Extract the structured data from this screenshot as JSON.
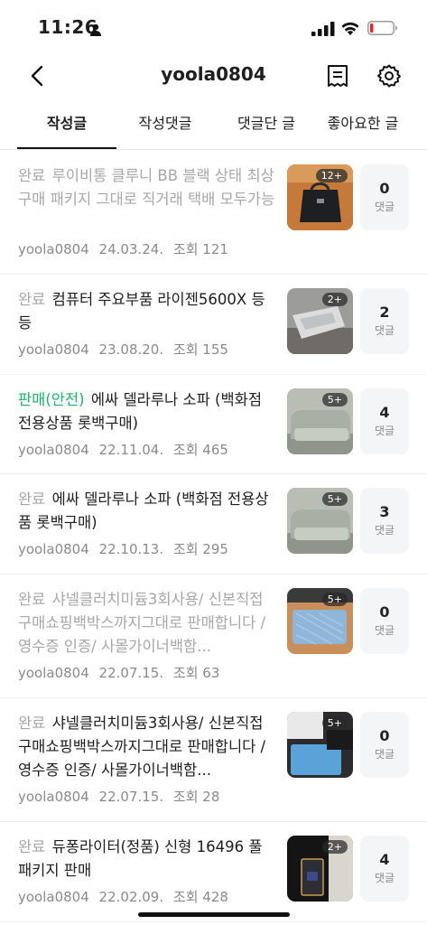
{
  "status_bar": {
    "time": "11:26"
  },
  "header": {
    "title": "yoola0804",
    "back_icon": "chevron-left-icon",
    "doc_icon": "receipt-icon",
    "settings_icon": "gear-icon"
  },
  "tabs": [
    {
      "label": "작성글",
      "active": true
    },
    {
      "label": "작성댓글",
      "active": false
    },
    {
      "label": "댓글단 글",
      "active": false
    },
    {
      "label": "좋아요한 글",
      "active": false
    }
  ],
  "colors": {
    "sale_status": "#1bb36a",
    "faded_text": "#a7a7a7",
    "meta_text": "#8a8a8a",
    "comment_box_bg": "#f4f5f7"
  },
  "posts": [
    {
      "status": "완료",
      "title": "루이비통 클루니 BB 블랙  상태 최상 구매 패키지 그대로 직거래 택배 모두가능",
      "author": "yoola0804",
      "date": "24.03.24.",
      "views": "조회 121",
      "image_count": "12+",
      "comments": "0",
      "comments_label": "댓글"
    },
    {
      "status": "완료",
      "title": "컴퓨터 주요부품 라이젠5600X 등등",
      "author": "yoola0804",
      "date": "23.08.20.",
      "views": "조회 155",
      "image_count": "2+",
      "comments": "2",
      "comments_label": "댓글"
    },
    {
      "status": "판매(안전)",
      "title": "에싸 델라루나 소파 (백화점 전용상품 롯백구매)",
      "author": "yoola0804",
      "date": "22.11.04.",
      "views": "조회 465",
      "image_count": "5+",
      "comments": "4",
      "comments_label": "댓글"
    },
    {
      "status": "완료",
      "title": "에싸 델라루나 소파 (백화점 전용상품 롯백구매)",
      "author": "yoola0804",
      "date": "22.10.13.",
      "views": "조회 295",
      "image_count": "5+",
      "comments": "3",
      "comments_label": "댓글"
    },
    {
      "status": "완료",
      "title": "샤넬클러치미듐3회사용/ 신본직접구매쇼핑백박스까지그대로 판매합니다 / 영수증 인증/ 사몰가이너백함...",
      "author": "yoola0804",
      "date": "22.07.15.",
      "views": "조회 63",
      "image_count": "5+",
      "comments": "0",
      "comments_label": "댓글"
    },
    {
      "status": "완료",
      "title": "샤넬클러치미듐3회사용/ 신본직접구매쇼핑백박스까지그대로 판매합니다 / 영수증 인증/ 사몰가이너백함...",
      "author": "yoola0804",
      "date": "22.07.15.",
      "views": "조회 28",
      "image_count": "5+",
      "comments": "0",
      "comments_label": "댓글"
    },
    {
      "status": "완료",
      "title": "듀퐁라이터(정품) 신형 16496 풀패키지 판매",
      "author": "yoola0804",
      "date": "22.02.09.",
      "views": "조회 428",
      "image_count": "2+",
      "comments": "4",
      "comments_label": "댓글"
    }
  ]
}
